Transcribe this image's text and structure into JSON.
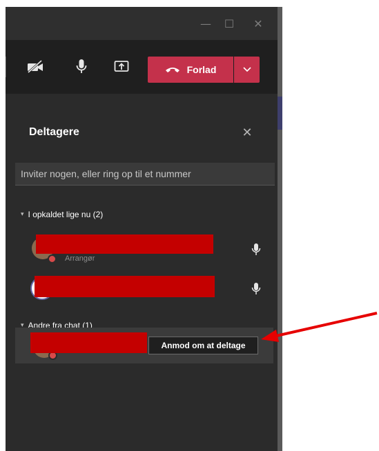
{
  "window": {
    "controls": {
      "minimize": "—",
      "maximize": "☐",
      "close": "✕"
    }
  },
  "toolbar": {
    "leave_label": "Forlad"
  },
  "participants_pane": {
    "title": "Deltagere",
    "close_glyph": "✕",
    "invite_placeholder": "Inviter nogen, eller ring op til et nummer",
    "sections": [
      {
        "label": "I opkaldet lige nu (2)"
      },
      {
        "label": "Andre fra chat (1)"
      }
    ],
    "in_call": [
      {
        "role": "Arrangør"
      }
    ],
    "request_button_label": "Anmod om at deltage"
  },
  "colors": {
    "leave_red": "#c4314b",
    "redaction_red": "#c40000",
    "annotation_arrow": "#e60000"
  },
  "icons": [
    "camera-off-icon",
    "microphone-icon",
    "share-screen-icon",
    "phone-hangup-icon",
    "chevron-down-icon",
    "close-icon",
    "caret-down-icon"
  ]
}
